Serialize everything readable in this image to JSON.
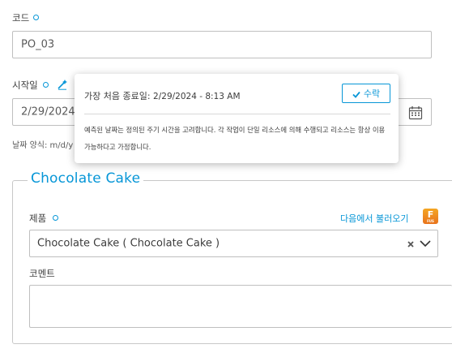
{
  "code": {
    "label": "코드",
    "value": "PO_03"
  },
  "start": {
    "label": "시작일",
    "value": "2/29/2024 -",
    "format_hint": "날짜 양식: m/d/y"
  },
  "popover": {
    "title_label": "가장 처음 종료일:",
    "title_value": "2/29/2024 - 8:13 AM",
    "accept_label": "수락",
    "body_line1": "예측된 날짜는 정의된 주기 시간을 고려합니다. 각 작업이 단일 리소스에 의해 수행되고 리소스는 항상 이용",
    "body_line2": "가능하다고 가정합니다."
  },
  "section": {
    "title": "Chocolate Cake",
    "product_label": "제품",
    "load_from_label": "다음에서 불러오기",
    "fusion_badge": "F",
    "fusion_badge_sub": "FUS",
    "product_value": "Chocolate Cake ( Chocolate Cake )",
    "comment_label": "코멘트",
    "comment_value": ""
  },
  "colors": {
    "accent": "#0696d7",
    "border": "#bfbfbf",
    "fusion": "#e8731c"
  },
  "icons": [
    "required-dot-icon",
    "wand-icon",
    "calendar-icon",
    "check-icon",
    "clear-icon",
    "chevron-down-icon",
    "fusion-icon"
  ]
}
